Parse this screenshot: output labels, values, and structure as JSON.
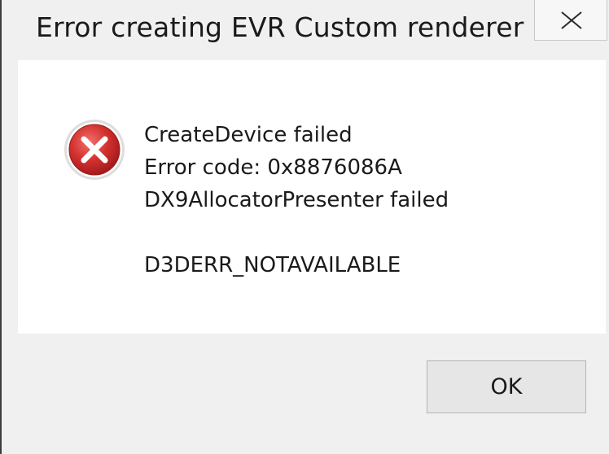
{
  "dialog": {
    "title": "Error creating EVR Custom renderer",
    "icon": "error-icon",
    "messages": {
      "line1": "CreateDevice failed",
      "line2": "Error code: 0x8876086A",
      "line3": "DX9AllocatorPresenter failed",
      "line4": "D3DERR_NOTAVAILABLE"
    },
    "ok_label": "OK",
    "close_icon": "close-icon"
  },
  "colors": {
    "window_bg": "#f0f0f0",
    "content_bg": "#ffffff",
    "error_red": "#c8282a",
    "text": "#1a1a1a"
  }
}
